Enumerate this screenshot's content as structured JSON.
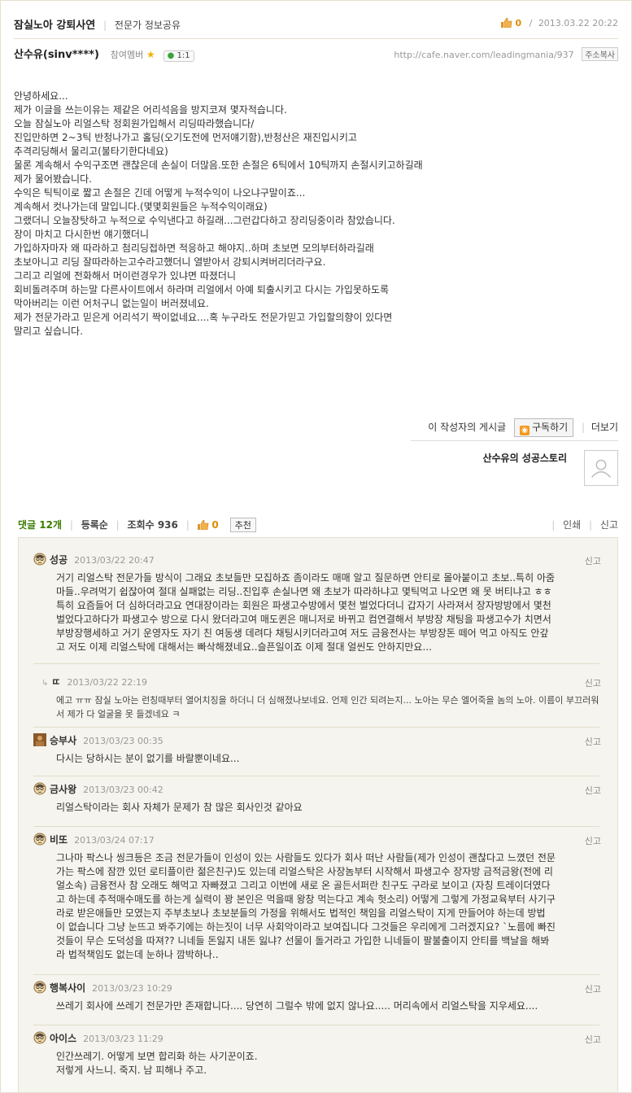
{
  "header": {
    "club_title": "잠실노아 강퇴사연",
    "category": "전문가 정보공유",
    "like_count": "0",
    "slash": "/",
    "datetime": "2013.03.22 20:22"
  },
  "author": {
    "nick": "산수유(sinv****)",
    "grade": "참여멤버",
    "chat_label": "1:1",
    "url": "http://cafe.naver.com/leadingmania/937",
    "copy_label": "주소복사"
  },
  "post": {
    "lines": [
      "안녕하세요...",
      "제가 이글을 쓰는이유는 제같은 어리석음을 방지코져 몇자적습니다.",
      "오늘 잠실노아 리얼스탁 정회원가입해서 리딩따라했습니다/",
      "진입만하면 2~3틱 반청나가고 홀딩(오기도전에 먼저얘기함),반청산은 재진입시키고",
      "추격리딩해서 물리고(불타기한다네요)",
      "물론 계속해서 수익구조면 괜찮은데 손실이 더많음.또한 손절은 6틱에서 10틱까지 손절시키고하길래",
      "제가 물어봤습니다.",
      "수익은 틱틱이로 짧고 손절은 긴데 어떻게 누적수익이 나오냐구말이죠...",
      "계속해서 컷나가는데 말입니다.(몇몇회원들은 누적수익이래요)",
      "그랬더니 오늘장탓하고 누적으로 수익낸다고 하길래...그런갑다하고 장리딩중이라 참았습니다.",
      "장이 마치고 다시한번 얘기했더니",
      "가입하자마자 왜 따라하고 첨리딩접하면 적응하고 해야지..하며 초보면 모의부터하라길래",
      "초보아니고 리딩 잘따라하는고수라고했더니 열받아서 강퇴시켜버리더라구요.",
      "그리고 리얼에 전화해서 머이런경우가 있냐면 따졌더니",
      "회비돌려주며 하는말 다른사이트에서 하라며 리얼에서 아예 퇴출시키고 다시는 가입못하도록",
      "막아버리는 이런 어처구니 없는일이 버러졌네요.",
      "제가 전문가라고 믿은게 어리석기 짝이없네요....혹 누구라도 전문가믿고 가입할의향이 있다면",
      "말리고 싶습니다."
    ]
  },
  "subscribe": {
    "prefix": "이 작성자의 게시글",
    "button": "구독하기",
    "more": "더보기"
  },
  "story": {
    "title": "산수유의 성공스토리"
  },
  "comment_bar": {
    "comments_label": "댓글 12개",
    "order_label": "등록순",
    "views_label": "조회수 936",
    "like_count": "0",
    "recommend_button": "추천",
    "print": "인쇄",
    "report": "신고",
    "sep": "|"
  },
  "comments": [
    {
      "nick": "성공",
      "date": "2013/03/22 20:47",
      "report": "신고",
      "lines": [
        "거기 리얼스탁 전문가들 방식이 그래요 초보들만 모집하죠 좀이라도 매매 알고 질문하면 안티로 몰아붙이고 초보..특히 아줌",
        "마들..우려먹기 쉽잖아여 절대 실패없는 리딩..진입후 손실나면 왜 초보가 따라하냐고 몇틱먹고 나오면 왜 못 버티냐고 ㅎㅎ",
        "특히 요즘들어 더 심하더라고요 연대장이라는 회원은 파생고수방에서 몇천 벌었다더니 갑자기 사라져서 장자방방에서 몇천",
        "벌었다고하다가 파생고수 방으로 다시 왔더라고여 매도퀸은 매니저로 바뀌고 컴연결해서 부방장 채팅을 파생고수가 치면서",
        "부방장행세하고 거기 운영자도 자기 친 여동생 데려다 채팅시키더라고여 저도 금융전사는 부방장돈 떼어 먹고 아직도 안갚",
        "고 저도 이제 리얼스탁에 대해서는 빠삭해졌네요..슬픈일이죠 이제 절대 얼씬도 안하지만요..."
      ]
    },
    {
      "nick": "ㄸ",
      "date": "2013/03/22 22:19",
      "report": "신고",
      "reply": true,
      "lines": [
        "에고 ㅠㅠ 잠실 노아는 런칭때부터 열어치징을 하더니 더 심해졌나보네요. 언제 인간 되려는지... 노아는 무슨 엘어죽을 놈의 노아. 이름이 부끄러워",
        "서 제가 다 얼굴을 못 들겠네요 ㅋ"
      ]
    },
    {
      "nick": "승부사",
      "date": "2013/03/23 00:35",
      "report": "신고",
      "lines": [
        "다시는 당하시는 분이 없기를 바랄뿐이네요..."
      ]
    },
    {
      "nick": "금사왕",
      "date": "2013/03/23 00:42",
      "report": "신고",
      "lines": [
        "리얼스탁이라는 회사 자체가 문제가 참 많은 회사인것 같아요"
      ]
    },
    {
      "nick": "비또",
      "date": "2013/03/24 07:17",
      "report": "신고",
      "lines": [
        "그나마 팍스나 씽크등은 조금 전문가들이 인성이 있는 사람들도 있다가 회사 떠난 사람들(제가 인성이 괜찮다고 느꼈던 전문",
        "가는 팍스에 잠깐 있던 로티플이란 젊은친구)도 있는데 리얼스탁은 사장놈부터 시작해서 파생고수 장자방 금적금왕(전에 리",
        "얼소속) 금융전사 참 오래도 해먹고 자빠졌고 그리고 이번에 새로 온 골든서퍼란 친구도 구라로 보이고 (자칭 트레이더였다",
        "고 하는데 추적매수매도를 하는게 실력이 꽝 본인은 먹을때 왕창 먹는다고 계속 헛소리) 어떻게 그렇게 가정교육부터 사기구",
        "라로 받은애들만 모였는지 주부초보나 초보분들의 가정을 위해서도 법적인 책임을 리얼스탁이 지게 만들어야 하는데 방법",
        "이 없습니다 그냥 눈뜨고 봐주기에는 하는짓이 너무 사회악이라고 보여집니다 그것들은 우리에게 그러겠지요? `노름에 빠진",
        "것들이 무슨 도덕성을 따져?? 니네들 돈잃지 내돈 잃냐? 선물이 돌거라고 가입한 니네들이 팔불출이지 안티를 백날을 해봐",
        "라 법적책임도 없는데 눈하나 깜박하나.."
      ]
    },
    {
      "nick": "행복사이",
      "date": "2013/03/23 10:29",
      "report": "신고",
      "lines": [
        "쓰레기 회사에 쓰레기 전문가만 존재합니다.... 당연히 그럴수 밖에 없지 않나요..... 머리속에서 리얼스탁을 지우세요...."
      ]
    },
    {
      "nick": "아이스",
      "date": "2013/03/23 11:29",
      "report": "신고",
      "lines": [
        "인간쓰레기. 어떻게 보면 합리화 하는 사기꾼이죠.",
        "저렇게 사느니. 죽지. 남 피해나 주고."
      ]
    }
  ],
  "colors": {
    "comment_count": "#3b7d00",
    "like": "#e08b00",
    "panel_bg": "#f5f4ee"
  }
}
